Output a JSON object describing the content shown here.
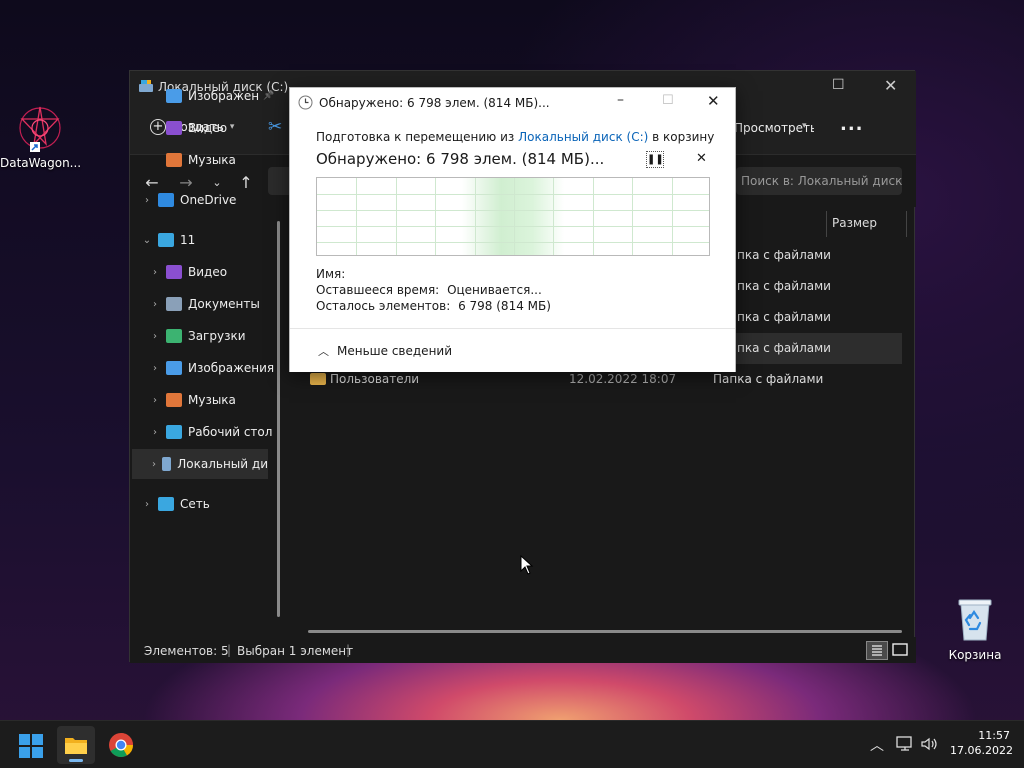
{
  "desktop": {
    "icons": [
      {
        "label": "DataWagon...",
        "icon": "datawagon-app-icon"
      },
      {
        "label": "Корзина",
        "icon": "recycle-bin-icon"
      }
    ]
  },
  "explorer": {
    "title": "Локальный диск (C:)",
    "toolbar": {
      "create": "Создать",
      "view": "Просмотреть",
      "more": "..."
    },
    "search_placeholder": "Поиск в: Локальный диск (...",
    "column_size": "Размер",
    "sidebar": [
      {
        "label": "Изображен",
        "icon": "pictures-icon",
        "color": "#4a9ce8",
        "pinned": true
      },
      {
        "label": "Видео",
        "icon": "videos-icon",
        "color": "#8a4fd0"
      },
      {
        "label": "Музыка",
        "icon": "music-icon",
        "color": "#e0763a"
      },
      {
        "label": "OneDrive",
        "icon": "onedrive-icon",
        "color": "#2f8ae0"
      },
      {
        "label": "11",
        "icon": "this-pc-icon",
        "color": "#3aa7e0"
      },
      {
        "label": "Видео",
        "icon": "videos-icon",
        "color": "#8a4fd0"
      },
      {
        "label": "Документы",
        "icon": "documents-icon",
        "color": "#8aa0b8"
      },
      {
        "label": "Загрузки",
        "icon": "downloads-icon",
        "color": "#3cb371"
      },
      {
        "label": "Изображения",
        "icon": "pictures-icon",
        "color": "#4a9ce8"
      },
      {
        "label": "Музыка",
        "icon": "music-icon",
        "color": "#e0763a"
      },
      {
        "label": "Рабочий стол",
        "icon": "desktop-icon",
        "color": "#3aa7e0"
      },
      {
        "label": "Локальный ди",
        "icon": "local-disk-icon",
        "color": "#7fa8d0",
        "selected": true
      },
      {
        "label": "Сеть",
        "icon": "network-icon",
        "color": "#3aa7e0"
      }
    ],
    "rows": [
      {
        "name": "",
        "date": "",
        "type": "пка с файлами"
      },
      {
        "name": "",
        "date": "",
        "type": "пка с файлами"
      },
      {
        "name": "",
        "date": "",
        "type": "пка с файлами"
      },
      {
        "name": "",
        "date": "",
        "type": "пка с файлами",
        "selected": true
      },
      {
        "name": "Пользователи",
        "date": "12.02.2022 18:07",
        "type": "Папка с файлами"
      }
    ],
    "status": {
      "count": "Элементов: 5",
      "selected": "Выбран 1 элемент"
    }
  },
  "dialog": {
    "title": "Обнаружено: 6 798 элем. (814 МБ)...",
    "prep_prefix": "Подготовка к перемещению из",
    "prep_link": "Локальный диск (C:)",
    "prep_suffix": "в корзину",
    "heading": "Обнаружено: 6 798 элем. (814 МБ)...",
    "progress": 0.47,
    "name_label": "Имя:",
    "time_label": "Оставшееся время:",
    "time_value": "Оценивается...",
    "remaining_label": "Осталось элементов:",
    "remaining_value": "6 798 (814 МБ)",
    "less_details": "Меньше сведений",
    "accent": "#0a64b8"
  },
  "taskbar": {
    "time": "11:57",
    "date": "17.06.2022"
  }
}
